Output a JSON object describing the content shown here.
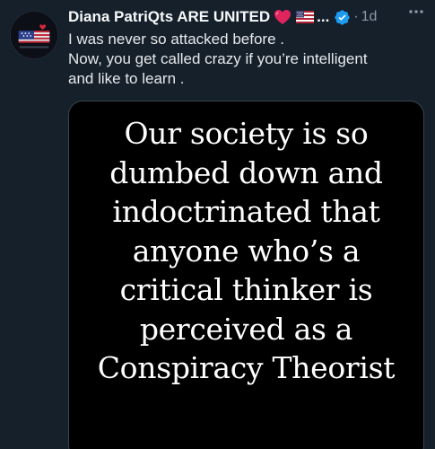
{
  "tweet": {
    "author_name": "Diana PatriQts ARE UNITED",
    "name_truncation": "...",
    "separator": "·",
    "time": "1d",
    "text_lines": [
      "I was never so attacked before .",
      "Now, you get called crazy if you’re intelligent",
      "and like to learn ."
    ],
    "icons": {
      "heart": "red-heart-emoji",
      "flag": "us-flag-emoji",
      "verified": "verified-badge-icon",
      "more": "more-options-icon",
      "avatar": "profile-avatar"
    },
    "colors": {
      "background": "#15202b",
      "secondary_text": "#8b98a5",
      "verified_blue": "#1d9bf0",
      "heart_red": "#e0245e"
    }
  },
  "media": {
    "quote_lines": [
      "Our society is so",
      "dumbed down and",
      "indoctrinated that",
      "anyone who’s a",
      "critical thinker is",
      "perceived as a",
      "Conspiracy Theorist"
    ]
  }
}
